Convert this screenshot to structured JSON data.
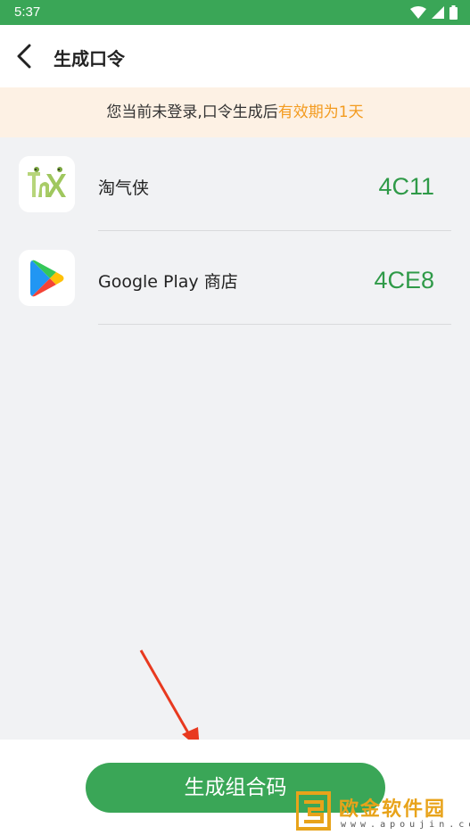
{
  "status_bar": {
    "time": "5:37",
    "icons": [
      "wifi-icon",
      "signal-icon",
      "battery-icon"
    ]
  },
  "header": {
    "title": "生成口令",
    "back_icon": "back-arrow-icon"
  },
  "notice": {
    "text": "您当前未登录,口令生成后",
    "accent_text": "有效期为1天",
    "accent_color": "#f39b1f"
  },
  "apps": [
    {
      "name": "淘气侠",
      "code": "4C11",
      "icon": "taoqixia-icon"
    },
    {
      "name": "Google Play 商店",
      "code": "4CE8",
      "icon": "google-play-icon"
    }
  ],
  "action": {
    "generate_label": "生成组合码"
  },
  "watermark": {
    "text": "欧金软件园",
    "url": "www.apoujin.com"
  },
  "colors": {
    "primary": "#3aa657",
    "code": "#2f9a48"
  }
}
